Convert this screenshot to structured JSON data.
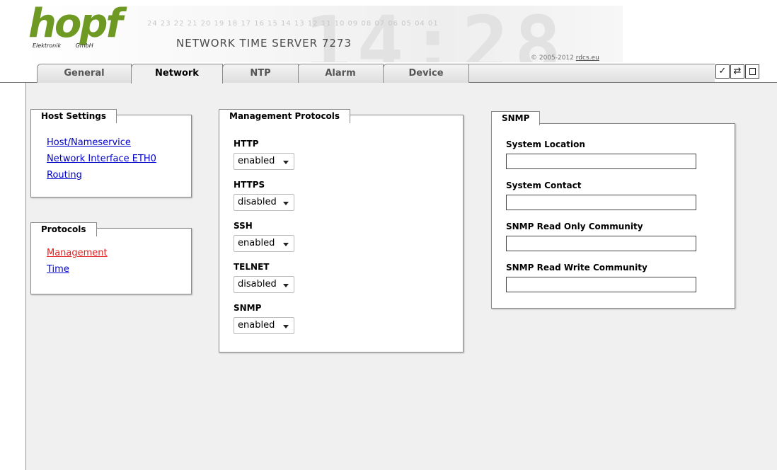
{
  "header": {
    "logo_text": "hopf",
    "logo_subtext": "Elektronik GmbH",
    "hours_strip": "24 23 22 21 20 19 18 17 16 15 14 13 12 11 10 09 08 07 06 05 04 01",
    "background_clock": "14:28",
    "product_title": "NETWORK TIME SERVER 7273",
    "copyright_prefix": "© 2005-2012 ",
    "copyright_link": "rdcs.eu"
  },
  "tabs": [
    {
      "label": "General",
      "active": false
    },
    {
      "label": "Network",
      "active": true
    },
    {
      "label": "NTP",
      "active": false
    },
    {
      "label": "Alarm",
      "active": false
    },
    {
      "label": "Device",
      "active": false
    }
  ],
  "actions": {
    "apply_icon": "check-icon",
    "apply_glyph": "✓",
    "reload_icon": "refresh-icon",
    "reload_glyph": "⇄",
    "save_icon": "square-icon"
  },
  "host_settings": {
    "title": "Host Settings",
    "links": [
      "Host/Nameservice",
      "Network Interface ETH0",
      "Routing"
    ]
  },
  "protocols_nav": {
    "title": "Protocols",
    "links": [
      "Management",
      "Time"
    ],
    "active": "Management"
  },
  "management": {
    "title": "Management Protocols",
    "fields": [
      {
        "label": "HTTP",
        "value": "enabled"
      },
      {
        "label": "HTTPS",
        "value": "disabled"
      },
      {
        "label": "SSH",
        "value": "enabled"
      },
      {
        "label": "TELNET",
        "value": "disabled"
      },
      {
        "label": "SNMP",
        "value": "enabled"
      }
    ]
  },
  "snmp": {
    "title": "SNMP",
    "fields": [
      {
        "label": "System Location",
        "value": ""
      },
      {
        "label": "System Contact",
        "value": ""
      },
      {
        "label": "SNMP Read Only Community",
        "value": ""
      },
      {
        "label": "SNMP Read Write Community",
        "value": ""
      }
    ]
  },
  "colors": {
    "logo_green": "#6e9a24",
    "link_blue": "#0000cc",
    "link_active_red": "#e02020",
    "content_bg": "#f0f0f0"
  }
}
